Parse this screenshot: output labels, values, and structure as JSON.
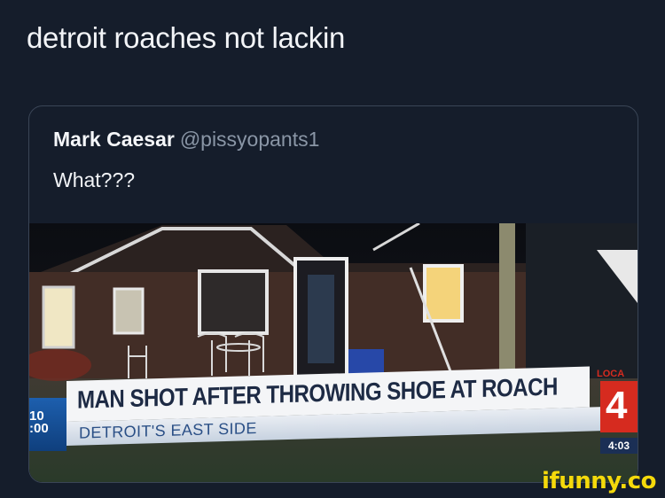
{
  "post": {
    "text": "detroit roaches not lackin"
  },
  "quoted_tweet": {
    "display_name": "Mark Caesar",
    "handle": "@pissyopants1",
    "text": "What???"
  },
  "news_graphic": {
    "headline": "MAN SHOT AFTER THROWING SHOE AT ROACH",
    "subheadline": "DETROIT'S EAST SIDE",
    "left_bug": "10\n:00",
    "station_logo": "4",
    "local_label": "LOCA",
    "time": "4:03"
  },
  "watermark": "ifunny.co",
  "colors": {
    "background": "#151d2b",
    "card_border": "#3a4556",
    "handle": "#8a96a6",
    "headline_text": "#1d2a44",
    "station_red": "#d62b1f",
    "watermark": "#f5d90b"
  }
}
